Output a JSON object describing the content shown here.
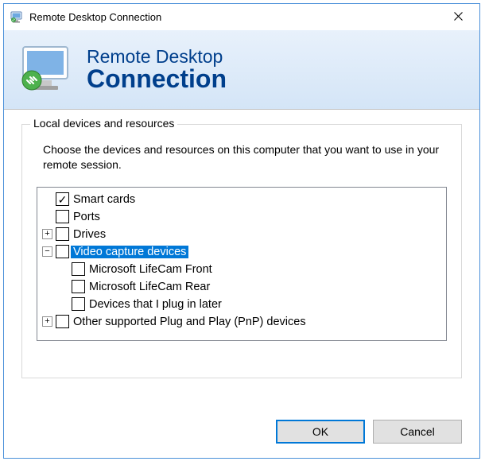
{
  "window": {
    "title": "Remote Desktop Connection",
    "close": "✕"
  },
  "banner": {
    "line1": "Remote Desktop",
    "line2": "Connection"
  },
  "group": {
    "label": "Local devices and resources",
    "instruction": "Choose the devices and resources on this computer that you want to use in your remote session."
  },
  "tree": {
    "items": [
      {
        "label": "Smart cards",
        "checked": true,
        "expander": "",
        "indent": 0,
        "selected": false
      },
      {
        "label": "Ports",
        "checked": false,
        "expander": "",
        "indent": 0,
        "selected": false
      },
      {
        "label": "Drives",
        "checked": false,
        "expander": "+",
        "indent": 0,
        "selected": false
      },
      {
        "label": "Video capture devices",
        "checked": false,
        "expander": "-",
        "indent": 0,
        "selected": true
      },
      {
        "label": "Microsoft LifeCam Front",
        "checked": false,
        "expander": "",
        "indent": 1,
        "selected": false
      },
      {
        "label": "Microsoft LifeCam Rear",
        "checked": false,
        "expander": "",
        "indent": 1,
        "selected": false
      },
      {
        "label": "Devices that I plug in later",
        "checked": false,
        "expander": "",
        "indent": 1,
        "selected": false
      },
      {
        "label": "Other supported Plug and Play (PnP) devices",
        "checked": false,
        "expander": "+",
        "indent": 0,
        "selected": false
      }
    ]
  },
  "buttons": {
    "ok": "OK",
    "cancel": "Cancel"
  }
}
